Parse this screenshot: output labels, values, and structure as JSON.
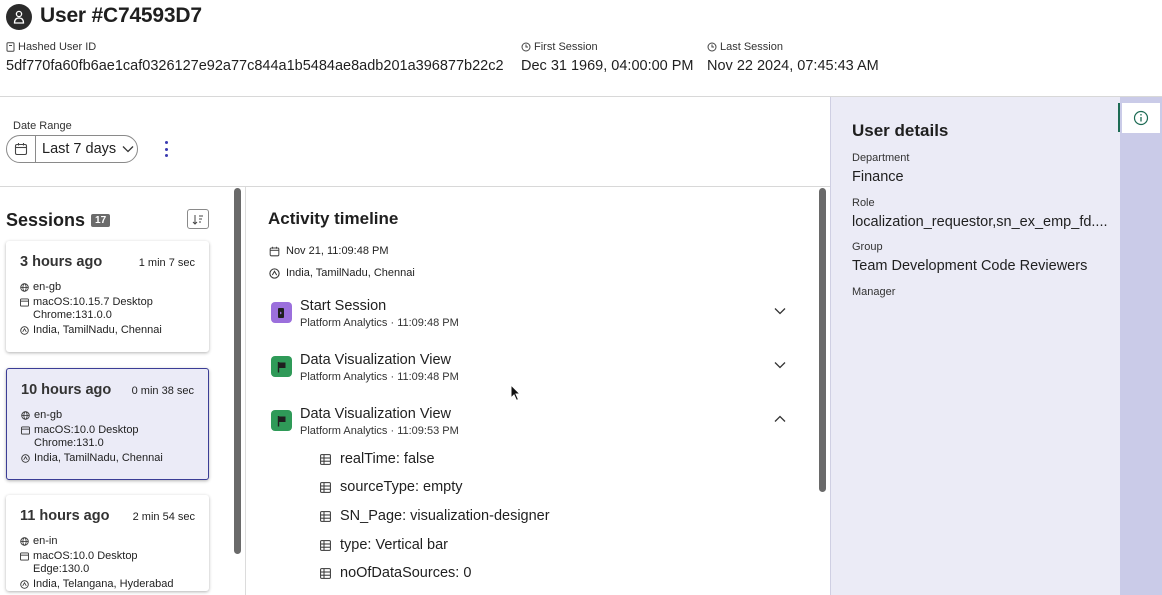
{
  "header": {
    "title": "User #C74593D7",
    "hashed_id_label": "Hashed User ID",
    "hashed_id_value": "5df770fa60fb6ae1caf0326127e92a77c844a1b5484ae8adb201a396877b22c2",
    "first_session_label": "First Session",
    "first_session_value": "Dec 31 1969, 04:00:00 PM",
    "last_session_label": "Last Session",
    "last_session_value": "Nov 22 2024, 07:45:43 AM"
  },
  "filters": {
    "date_range_label": "Date Range",
    "date_range_value": "Last 7 days"
  },
  "sessions": {
    "title": "Sessions",
    "count": "17",
    "items": [
      {
        "ago": "3 hours ago",
        "duration": "1 min 7 sec",
        "locale": "en-gb",
        "platform": "macOS:10.15.7 Desktop Chrome:131.0.0",
        "location": "India, TamilNadu, Chennai"
      },
      {
        "ago": "10 hours ago",
        "duration": "0 min 38 sec",
        "locale": "en-gb",
        "platform": "macOS:10.0 Desktop Chrome:131.0",
        "location": "India, TamilNadu, Chennai"
      },
      {
        "ago": "11 hours ago",
        "duration": "2 min 54 sec",
        "locale": "en-in",
        "platform": "macOS:10.0 Desktop Edge:130.0",
        "location": "India, Telangana, Hyderabad"
      }
    ]
  },
  "activity": {
    "title": "Activity timeline",
    "date": "Nov 21, 11:09:48 PM",
    "location": "India, TamilNadu, Chennai",
    "events": [
      {
        "title": "Start Session",
        "sub": "Platform Analytics · 11:09:48 PM"
      },
      {
        "title": "Data Visualization View",
        "sub": "Platform Analytics · 11:09:48 PM"
      },
      {
        "title": "Data Visualization View",
        "sub": "Platform Analytics · 11:09:53 PM"
      }
    ],
    "properties": [
      "realTime: false",
      "sourceType: empty",
      "SN_Page: visualization-designer",
      "type: Vertical bar",
      "noOfDataSources: 0"
    ]
  },
  "details": {
    "title": "User details",
    "department_label": "Department",
    "department_value": "Finance",
    "role_label": "Role",
    "role_value": "localization_requestor,sn_ex_emp_fd....",
    "group_label": "Group",
    "group_value": "Team Development Code Reviewers",
    "manager_label": "Manager"
  },
  "colors": {
    "accent": "#3b3d96",
    "session_event": "#9b6fdc",
    "view_event": "#2f9a58",
    "right_panel": "#ebebf6",
    "right_rail": "#cacbe8"
  },
  "icons": [
    "user-icon",
    "key-icon",
    "clock-icon",
    "calendar-icon",
    "chevron-down-icon",
    "more-icon",
    "sort-icon",
    "globe-icon",
    "browser-icon",
    "location-icon",
    "session-icon",
    "flag-icon",
    "chevron-up-icon",
    "table-icon",
    "info-icon"
  ]
}
